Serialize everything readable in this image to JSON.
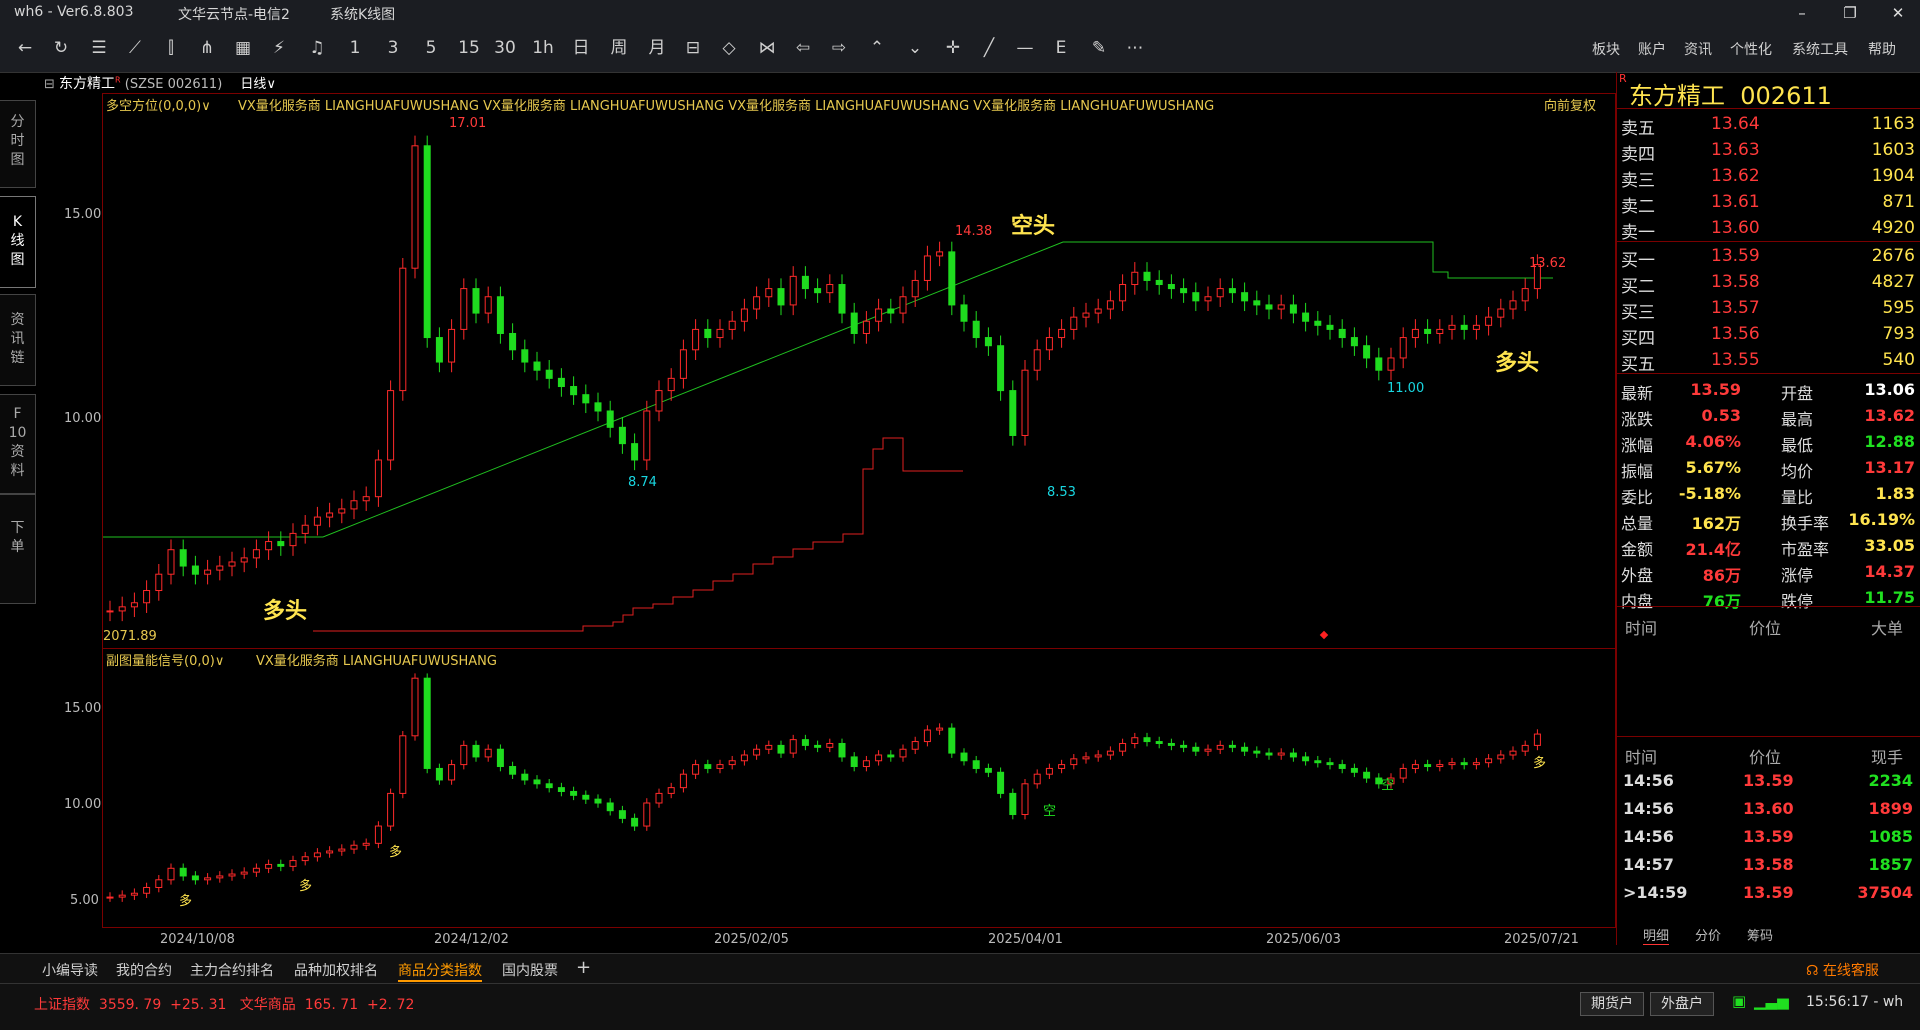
{
  "titlebar": {
    "app": "wh6 - Ver6.8.803",
    "server": "文华云节点-电信2",
    "view": "系统K线图",
    "min": "–",
    "restore": "❐",
    "close": "✕"
  },
  "toolbar": {
    "periods": [
      "1",
      "3",
      "5",
      "15",
      "30",
      "1h",
      "日",
      "周",
      "月"
    ],
    "menus": [
      "板块",
      "账户",
      "资讯",
      "个性化",
      "系统工具",
      "帮助"
    ]
  },
  "symbol": {
    "name": "东方精工",
    "code": "(SZSE 002611)",
    "period": "日线",
    "period_arrow": "∨",
    "flag": "R"
  },
  "left_tabs": [
    {
      "label": "分\n时\n图"
    },
    {
      "label": "K\n线\n图"
    },
    {
      "label": "资\n讯\n链"
    },
    {
      "label": "F\n10\n资\n料"
    },
    {
      "label": "下\n单"
    }
  ],
  "main_indicator": {
    "title": "多空方位(0,0,0)∨",
    "watermark": "VX量化服务商  LIANGHUAFUWUSHANG  VX量化服务商  LIANGHUAFUWUSHANG  VX量化服务商  LIANGHUAFUWUSHANG  VX量化服务商  LIANGHUAFUWUSHANG",
    "adjust": "向前复权",
    "y_ticks": [
      "15.00",
      "10.00"
    ],
    "labels": {
      "high1": "17.01",
      "high2": "14.38",
      "high3": "13.62",
      "low1": "8.74",
      "low2": "8.53",
      "low3": "11.00",
      "start_low": "2071.89",
      "kong": "空头",
      "duo1": "多头",
      "duo2": "多头"
    }
  },
  "sub_indicator": {
    "title": "副图量能信号(0,0)∨",
    "watermark": "VX量化服务商  LIANGHUAFUWUSHANG",
    "y_ticks": [
      "15.00",
      "10.00",
      "5.00"
    ],
    "signals": [
      "多",
      "多",
      "多",
      "空",
      "空",
      "多"
    ]
  },
  "x_axis": [
    "2024/10/08",
    "2024/12/02",
    "2025/02/05",
    "2025/04/01",
    "2025/06/03",
    "2025/07/21"
  ],
  "quote": {
    "name": "东方精工",
    "code": "002611",
    "asks": [
      {
        "label": "卖五",
        "price": "13.64",
        "vol": "1163"
      },
      {
        "label": "卖四",
        "price": "13.63",
        "vol": "1603"
      },
      {
        "label": "卖三",
        "price": "13.62",
        "vol": "1904"
      },
      {
        "label": "卖二",
        "price": "13.61",
        "vol": "871"
      },
      {
        "label": "卖一",
        "price": "13.60",
        "vol": "4920"
      }
    ],
    "bids": [
      {
        "label": "买一",
        "price": "13.59",
        "vol": "2676"
      },
      {
        "label": "买二",
        "price": "13.58",
        "vol": "4827"
      },
      {
        "label": "买三",
        "price": "13.57",
        "vol": "595"
      },
      {
        "label": "买四",
        "price": "13.56",
        "vol": "793"
      },
      {
        "label": "买五",
        "price": "13.55",
        "vol": "540"
      }
    ],
    "stats": [
      {
        "l1": "最新",
        "v1": "13.59",
        "c1": "red",
        "l2": "开盘",
        "v2": "13.06",
        "c2": "white"
      },
      {
        "l1": "涨跌",
        "v1": "0.53",
        "c1": "red",
        "l2": "最高",
        "v2": "13.62",
        "c2": "red"
      },
      {
        "l1": "涨幅",
        "v1": "4.06%",
        "c1": "red",
        "l2": "最低",
        "v2": "12.88",
        "c2": "green"
      },
      {
        "l1": "振幅",
        "v1": "5.67%",
        "c1": "yel",
        "l2": "均价",
        "v2": "13.17",
        "c2": "red"
      },
      {
        "l1": "委比",
        "v1": "-5.18%",
        "c1": "yel",
        "l2": "量比",
        "v2": "1.83",
        "c2": "yel"
      },
      {
        "l1": "总量",
        "v1": "162万",
        "c1": "yel",
        "l2": "换手率",
        "v2": "16.19%",
        "c2": "yel"
      },
      {
        "l1": "金额",
        "v1": "21.4亿",
        "c1": "red",
        "l2": "市盈率",
        "v2": "33.05",
        "c2": "yel"
      },
      {
        "l1": "外盘",
        "v1": "86万",
        "c1": "red",
        "l2": "涨停",
        "v2": "14.37",
        "c2": "red"
      },
      {
        "l1": "内盘",
        "v1": "76万",
        "c1": "green",
        "l2": "跌停",
        "v2": "11.75",
        "c2": "green"
      }
    ],
    "big_header": {
      "time": "时间",
      "price": "价位",
      "vol": "大单"
    },
    "tick_header": {
      "time": "时间",
      "price": "价位",
      "vol": "现手"
    },
    "ticks": [
      {
        "time": "14:56",
        "price": "13.59",
        "vol": "2234",
        "pc": "red",
        "vc": "green"
      },
      {
        "time": "14:56",
        "price": "13.60",
        "vol": "1899",
        "pc": "red",
        "vc": "red"
      },
      {
        "time": "14:56",
        "price": "13.59",
        "vol": "1085",
        "pc": "red",
        "vc": "green"
      },
      {
        "time": "14:57",
        "price": "13.58",
        "vol": "1857",
        "pc": "red",
        "vc": "green"
      },
      {
        "time": ">14:59",
        "price": "13.59",
        "vol": "37504",
        "pc": "red",
        "vc": "red"
      }
    ],
    "tabs": [
      "明细",
      "分价",
      "筹码"
    ]
  },
  "bottom_tabs": [
    "小编导读",
    "我的合约",
    "主力合约排名",
    "品种加权排名",
    "商品分类指数",
    "国内股票",
    "+"
  ],
  "bottom_active": 4,
  "service": "在线客服",
  "status": {
    "idx1_name": "上证指数",
    "idx1_val": "3559. 79",
    "idx1_chg": "+25. 31",
    "idx2_name": "文华商品",
    "idx2_val": "165. 71",
    "idx2_chg": "+2. 72",
    "btn1": "期货户",
    "btn2": "外盘户",
    "time": "15:56:17 - wh"
  },
  "chart_data": {
    "type": "candlestick",
    "series": [
      {
        "values": [
          5.1,
          5.2,
          5.3,
          5.6,
          6.0,
          6.6,
          6.2,
          6.0,
          6.1,
          6.2,
          6.3,
          6.4,
          6.6,
          6.8,
          6.7,
          7.0,
          7.2,
          7.4,
          7.5,
          7.6,
          7.8,
          7.9,
          8.8,
          10.5,
          13.5,
          16.5,
          11.8,
          11.2,
          12.0,
          13.0,
          12.4,
          12.8,
          11.9,
          11.5,
          11.2,
          11.0,
          10.8,
          10.6,
          10.4,
          10.2,
          10.0,
          9.6,
          9.2,
          8.8,
          10.0,
          10.5,
          10.8,
          11.5,
          12.0,
          11.8,
          12.0,
          12.2,
          12.5,
          12.8,
          13.0,
          12.6,
          13.3,
          13.0,
          12.9,
          13.1,
          12.4,
          11.9,
          12.2,
          12.5,
          12.4,
          12.8,
          13.2,
          13.8,
          13.9,
          12.6,
          12.2,
          11.8,
          11.6,
          10.5,
          9.4,
          11.0,
          11.5,
          11.8,
          12.0,
          12.3,
          12.4,
          12.5,
          12.7,
          13.1,
          13.4,
          13.2,
          13.1,
          13.0,
          12.9,
          12.7,
          12.8,
          13.0,
          12.9,
          12.7,
          12.6,
          12.5,
          12.6,
          12.4,
          12.2,
          12.1,
          12.0,
          11.8,
          11.6,
          11.3,
          11.0,
          11.3,
          11.8,
          12.0,
          11.9,
          12.0,
          12.1,
          12.0,
          12.1,
          12.3,
          12.5,
          12.7,
          13.0,
          13.59
        ]
      }
    ],
    "y_ticks": [
      15.0,
      10.0
    ]
  }
}
